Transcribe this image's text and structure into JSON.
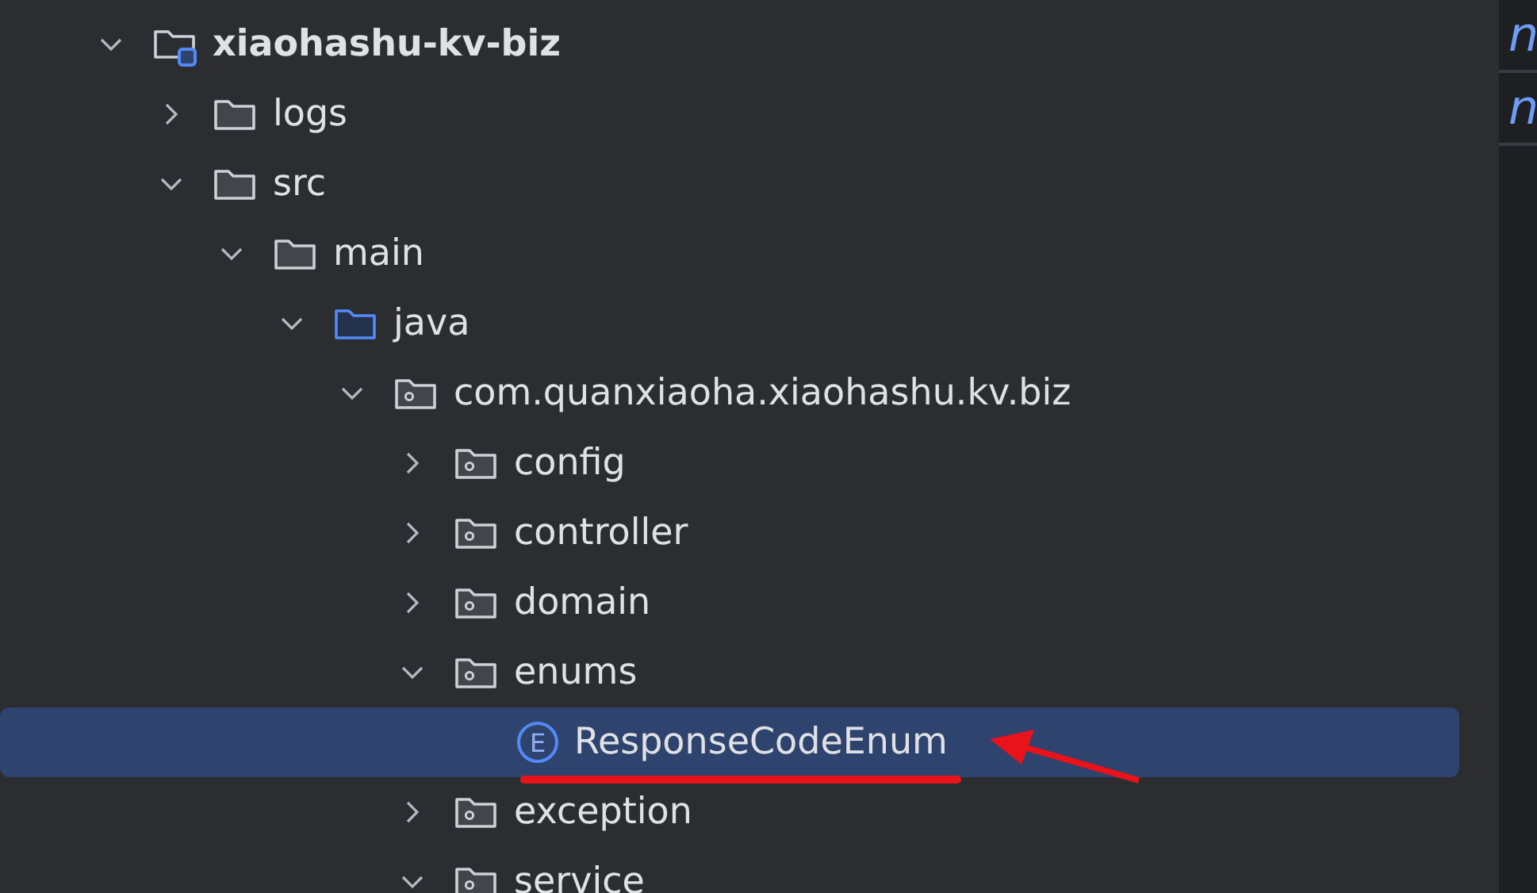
{
  "project_tree": [
    {
      "label": "xiaohashu-kv-biz",
      "kind": "module",
      "expanded": true,
      "selected": false,
      "children": [
        {
          "label": "logs",
          "kind": "folder",
          "expanded": false,
          "selected": false
        },
        {
          "label": "src",
          "kind": "folder",
          "expanded": true,
          "selected": false,
          "children": [
            {
              "label": "main",
              "kind": "folder",
              "expanded": true,
              "selected": false,
              "children": [
                {
                  "label": "java",
                  "kind": "source_folder",
                  "expanded": true,
                  "selected": false,
                  "children": [
                    {
                      "label": "com.quanxiaoha.xiaohashu.kv.biz",
                      "kind": "package",
                      "expanded": true,
                      "selected": false,
                      "children": [
                        {
                          "label": "config",
                          "kind": "package",
                          "expanded": false,
                          "selected": false
                        },
                        {
                          "label": "controller",
                          "kind": "package",
                          "expanded": false,
                          "selected": false
                        },
                        {
                          "label": "domain",
                          "kind": "package",
                          "expanded": false,
                          "selected": false
                        },
                        {
                          "label": "enums",
                          "kind": "package",
                          "expanded": true,
                          "selected": false,
                          "children": [
                            {
                              "label": "ResponseCodeEnum",
                              "kind": "enum",
                              "badge": "E",
                              "selected": true,
                              "annotated": true
                            }
                          ]
                        },
                        {
                          "label": "exception",
                          "kind": "package",
                          "expanded": false,
                          "selected": false
                        },
                        {
                          "label": "service",
                          "kind": "package",
                          "expanded": true,
                          "selected": false
                        }
                      ]
                    }
                  ]
                }
              ]
            }
          ]
        }
      ]
    }
  ],
  "editor_lines": [
    "n",
    "n"
  ]
}
